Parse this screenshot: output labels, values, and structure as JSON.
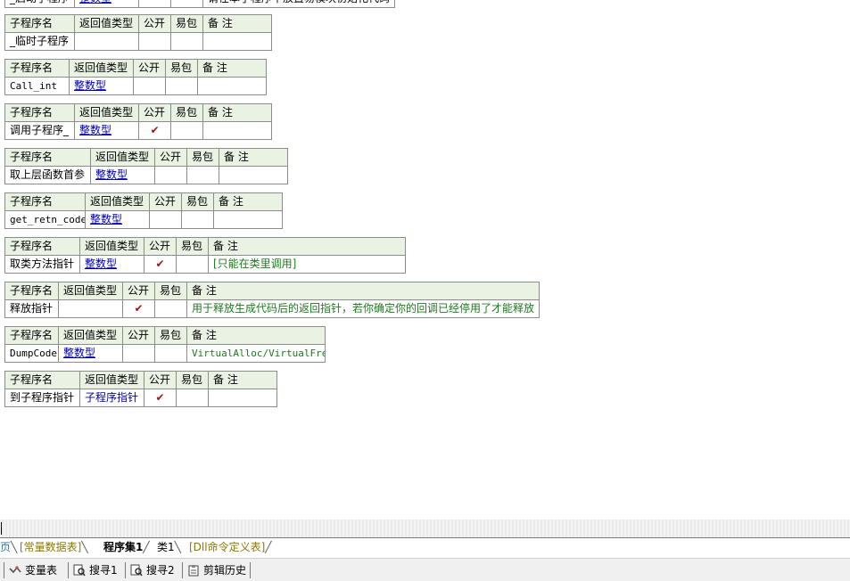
{
  "header_labels": {
    "name": "子程序名",
    "ret": "返回值类型",
    "pub": "公开",
    "easy": "易包",
    "note": "备 注"
  },
  "top_partial": {
    "name": "_启动子程序",
    "ret": "整数型",
    "note": "请在本子程序中放置易模块初始化代码"
  },
  "procs": [
    {
      "name": "_临时子程序",
      "ret": "",
      "pub": "",
      "note": ""
    },
    {
      "name": "Call_int",
      "ret": "整数型",
      "pub": "",
      "note": ""
    },
    {
      "name": "调用子程序_",
      "ret": "整数型",
      "pub": "✔",
      "note": ""
    },
    {
      "name": "取上层函数首参",
      "ret": "整数型",
      "pub": "",
      "note": ""
    },
    {
      "name": "get_retn_code",
      "ret": "整数型",
      "pub": "",
      "note": ""
    },
    {
      "name": "取类方法指针",
      "ret": "整数型",
      "pub": "✔",
      "note": "[只能在类里调用]"
    },
    {
      "name": "释放指针",
      "ret": "",
      "pub": "✔",
      "note": "用于释放生成代码后的返回指针，若你确定你的回调已经停用了才能释放"
    },
    {
      "name": "DumpCode",
      "ret": "整数型",
      "pub": "",
      "note": "VirtualAlloc/VirtualFree"
    },
    {
      "name": "到子程序指针",
      "ret": "子程序指针",
      "pub": "✔",
      "note": ""
    }
  ],
  "tabs": {
    "t0": "页",
    "t1": "[常量数据表]",
    "t2": "程序集1",
    "t3": "类1",
    "t4": "[Dll命令定义表]"
  },
  "bottom_tabs": {
    "b1": "变量表",
    "b2": "搜寻1",
    "b3": "搜寻2",
    "b4": "剪辑历史"
  },
  "colors": {
    "header_bg": "#eaf2e4",
    "type_link": "#0000a8",
    "note_green": "#1e7a1e",
    "check": "#a01818"
  }
}
